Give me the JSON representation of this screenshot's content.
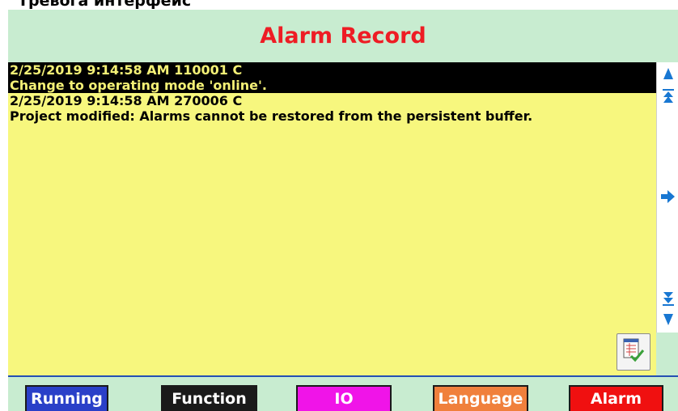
{
  "caption": "Тревога интерфейс",
  "header": {
    "title": "Alarm Record"
  },
  "alarms": [
    {
      "line1": "2/25/2019 9:14:58 AM 110001 C",
      "line2": "Change to operating mode 'online'."
    },
    {
      "line1": "2/25/2019 9:14:58 AM 270006 C",
      "line2": "Project modified: Alarms cannot be restored from the persistent buffer."
    }
  ],
  "scroll_buttons": [
    "scroll-up-icon",
    "page-up-icon",
    "scroll-right-icon",
    "page-down-icon",
    "scroll-down-icon"
  ],
  "acknowledge_icon": "acknowledge-checklist-icon",
  "nav": {
    "running": "Running",
    "function": "Function",
    "io": "IO",
    "language": "Language",
    "alarm": "Alarm"
  },
  "colors": {
    "header_bg": "#c8ecd0",
    "title": "#ee1c24",
    "list_bg": "#f7f77e",
    "selected_text": "#f4f076",
    "running": "#2a40c8",
    "function": "#1a1a1a",
    "io": "#f014e8",
    "language": "#f0803c",
    "alarm": "#f01010"
  }
}
